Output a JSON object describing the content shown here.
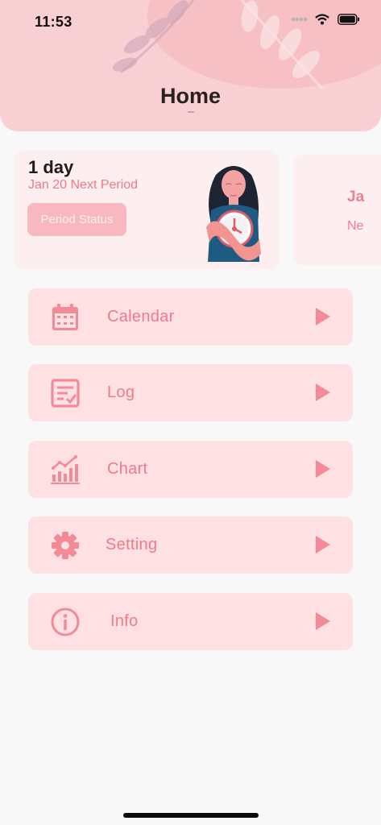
{
  "status_bar": {
    "time": "11:53"
  },
  "header": {
    "title": "Home"
  },
  "period_card": {
    "days_left": "1 day",
    "next_period": "Jan 20 Next Period",
    "status_button": "Period Status"
  },
  "next_card": {
    "date_partial": "Ja",
    "label_partial": "Ne"
  },
  "menu": [
    {
      "label": "Calendar",
      "icon": "calendar-icon"
    },
    {
      "label": "Log",
      "icon": "log-icon"
    },
    {
      "label": "Chart",
      "icon": "chart-icon"
    },
    {
      "label": "Setting",
      "icon": "gear-icon"
    },
    {
      "label": "Info",
      "icon": "info-icon"
    }
  ],
  "colors": {
    "accent": "#f07a8a",
    "header_bg": "#f8cfd2",
    "menu_bg": "#ffe1e4",
    "card_bg": "#fdeef0",
    "chip_bg": "#f9b7bf"
  }
}
